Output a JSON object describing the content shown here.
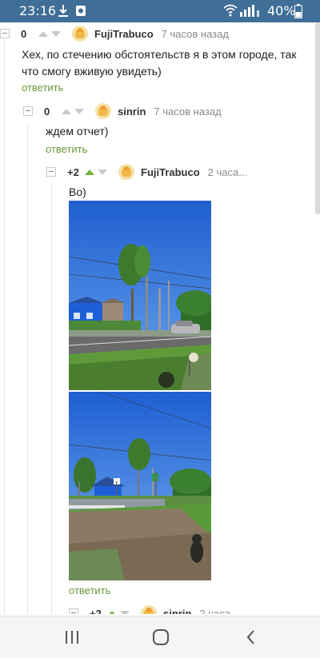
{
  "status_bar": {
    "time": "23:16",
    "battery": "40%",
    "icons": [
      "download-icon",
      "app-notification-icon",
      "wifi-icon",
      "signal-icon",
      "battery-icon"
    ]
  },
  "comments": [
    {
      "rating": "0",
      "nick": "FujiTrabuco",
      "time": "7 часов назад",
      "text": "Хех, по стечению обстоятельств я в этом городе, так что смогу вживую увидеть)",
      "reply": "ответить"
    },
    {
      "rating": "0",
      "nick": "sinrin",
      "time": "7 часов назад",
      "text": "ждем отчет)",
      "reply": "ответить"
    },
    {
      "rating": "+2",
      "nick": "FujiTrabuco",
      "time": "2 часа...",
      "text": "Во)",
      "reply": "ответить",
      "upvoted": true
    },
    {
      "rating": "+2",
      "nick": "sinrin",
      "time": "2 часа",
      "upvoted": true
    }
  ],
  "nav": {
    "icons": [
      "recent-apps-icon",
      "home-icon",
      "back-icon"
    ]
  },
  "colors": {
    "status_bar": "#3f6e96",
    "reply_link": "#6a9a3c",
    "upvote_active": "#76b041",
    "vote_inactive": "#c9c9c9"
  }
}
